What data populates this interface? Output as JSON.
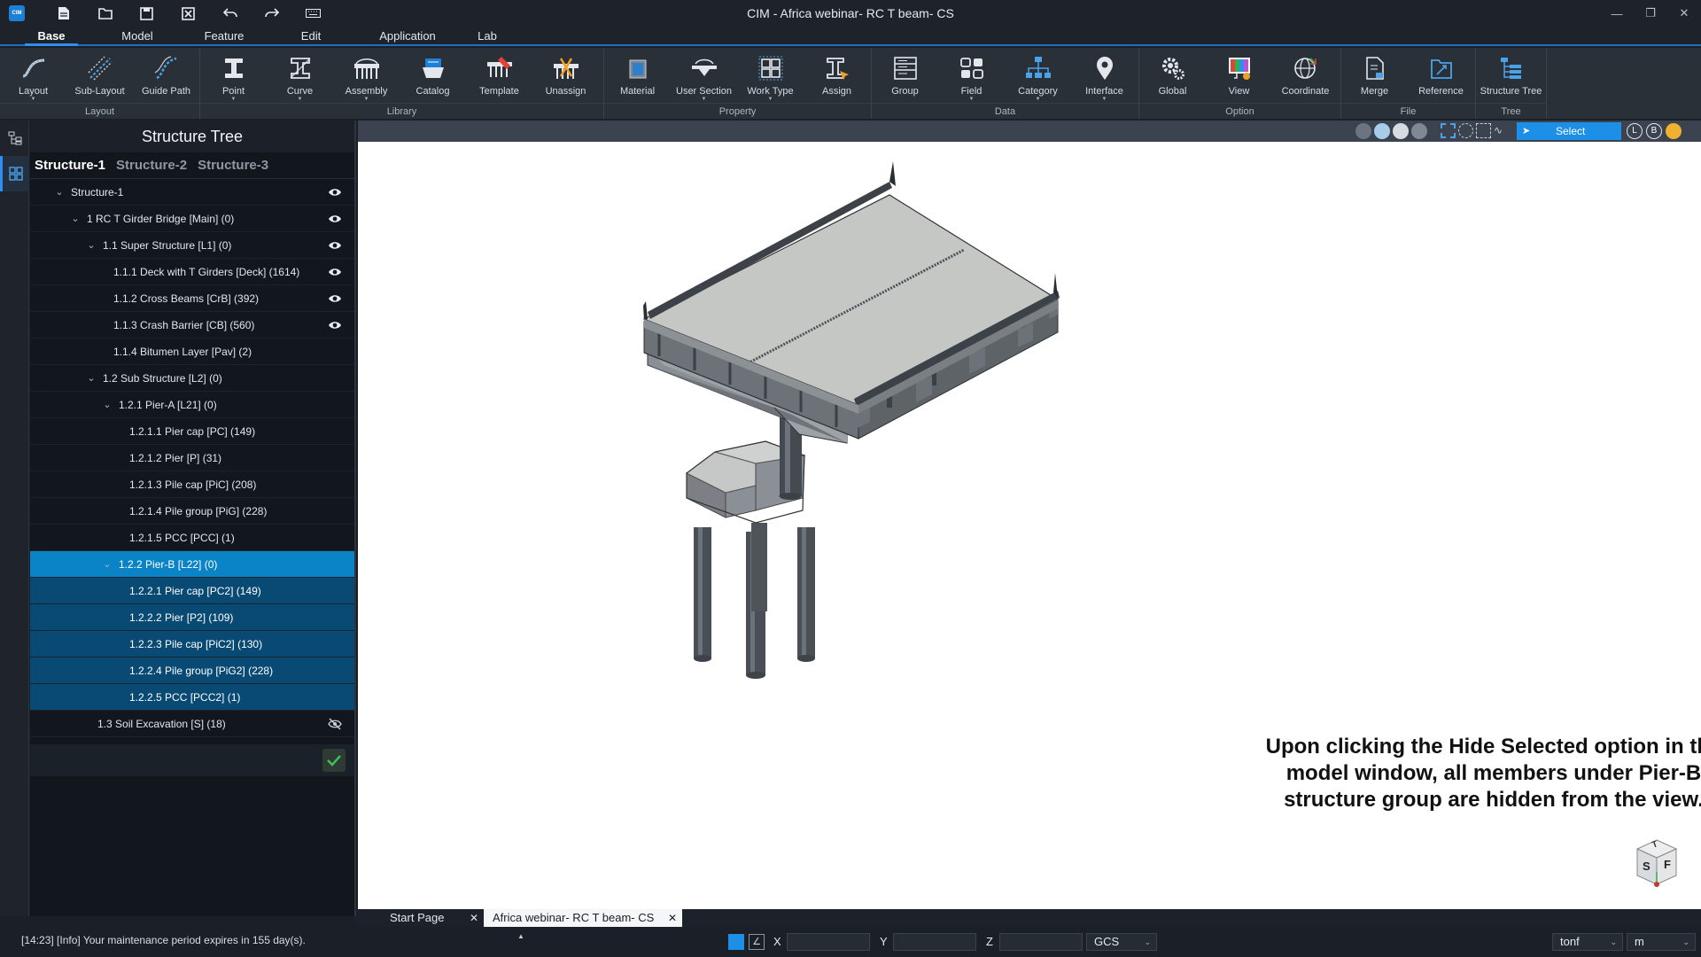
{
  "window": {
    "title": "CIM - Africa webinar- RC T beam- CS",
    "app_icon_text": "CIM",
    "controls": [
      "minimize",
      "restore",
      "close"
    ]
  },
  "quick_access": [
    "new-file-icon",
    "open-folder-icon",
    "save-icon",
    "close-file-icon",
    "undo-icon",
    "redo-icon",
    "keyboard-icon"
  ],
  "menu": {
    "tabs": [
      "Base",
      "Model",
      "Feature",
      "Edit",
      "Application",
      "Lab"
    ],
    "active": "Base"
  },
  "ribbon": {
    "groups": [
      {
        "label": "Layout",
        "items": [
          {
            "label": "Layout",
            "icon": "layout-curve-icon",
            "caret": true
          },
          {
            "label": "Sub-Layout",
            "icon": "sub-layout-icon",
            "caret": false
          },
          {
            "label": "Guide Path",
            "icon": "guide-path-icon",
            "caret": false
          }
        ]
      },
      {
        "label": "Library",
        "items": [
          {
            "label": "Point",
            "icon": "point-section-icon",
            "caret": true
          },
          {
            "label": "Curve",
            "icon": "curve-section-icon",
            "caret": true
          },
          {
            "label": "Assembly",
            "icon": "assembly-icon",
            "caret": true
          },
          {
            "label": "Catalog",
            "icon": "catalog-icon",
            "caret": false
          },
          {
            "label": "Template",
            "icon": "template-icon",
            "caret": false
          },
          {
            "label": "Unassign",
            "icon": "unassign-icon",
            "caret": false
          }
        ]
      },
      {
        "label": "Property",
        "items": [
          {
            "label": "Material",
            "icon": "material-cube-icon",
            "caret": false
          },
          {
            "label": "User Section",
            "icon": "user-section-icon",
            "caret": true
          },
          {
            "label": "Work Type",
            "icon": "work-type-grid-icon",
            "caret": true
          },
          {
            "label": "Assign",
            "icon": "assign-icon",
            "caret": false
          }
        ]
      },
      {
        "label": "Data",
        "items": [
          {
            "label": "Group",
            "icon": "group-list-icon",
            "caret": false
          },
          {
            "label": "Field",
            "icon": "field-icon",
            "caret": true
          },
          {
            "label": "Category",
            "icon": "category-tree-icon",
            "caret": true
          },
          {
            "label": "Interface",
            "icon": "interface-pin-icon",
            "caret": true
          }
        ]
      },
      {
        "label": "Option",
        "items": [
          {
            "label": "Global",
            "icon": "gear-icon",
            "caret": false
          },
          {
            "label": "View",
            "icon": "view-palette-icon",
            "caret": false
          },
          {
            "label": "Coordinate",
            "icon": "coordinate-globe-icon",
            "caret": false
          }
        ]
      },
      {
        "label": "File",
        "items": [
          {
            "label": "Merge",
            "icon": "merge-file-icon",
            "caret": false
          },
          {
            "label": "Reference",
            "icon": "reference-file-icon",
            "caret": false
          }
        ]
      },
      {
        "label": "Tree",
        "items": [
          {
            "label": "Structure Tree",
            "icon": "structure-tree-icon",
            "caret": false
          }
        ]
      }
    ]
  },
  "tree_panel": {
    "title": "Structure Tree",
    "structure_tabs": [
      "Structure-1",
      "Structure-2",
      "Structure-3"
    ],
    "active_tab": "Structure-1",
    "nodes": [
      {
        "label": "Structure-1",
        "depth": 0,
        "toggle": "expanded",
        "eye": "visible",
        "state": "normal"
      },
      {
        "label": "1 RC T Girder Bridge [Main] (0)",
        "depth": 1,
        "toggle": "expanded",
        "eye": "visible",
        "state": "normal"
      },
      {
        "label": "1.1 Super Structure [L1] (0)",
        "depth": 2,
        "toggle": "expanded",
        "eye": "visible",
        "state": "normal"
      },
      {
        "label": "1.1.1 Deck with T Girders [Deck] (1614)",
        "depth": 3,
        "toggle": "none",
        "eye": "visible",
        "state": "normal"
      },
      {
        "label": "1.1.2 Cross Beams [CrB] (392)",
        "depth": 3,
        "toggle": "none",
        "eye": "visible",
        "state": "normal"
      },
      {
        "label": "1.1.3 Crash Barrier [CB] (560)",
        "depth": 3,
        "toggle": "none",
        "eye": "visible",
        "state": "normal"
      },
      {
        "label": "1.1.4 Bitumen Layer [Pav] (2)",
        "depth": 3,
        "toggle": "none",
        "eye": "none",
        "state": "normal"
      },
      {
        "label": "1.2 Sub Structure [L2] (0)",
        "depth": 2,
        "toggle": "expanded",
        "eye": "none",
        "state": "normal"
      },
      {
        "label": "1.2.1 Pier-A [L21] (0)",
        "depth": 3,
        "toggle": "expanded",
        "eye": "none",
        "state": "normal"
      },
      {
        "label": "1.2.1.1 Pier cap [PC] (149)",
        "depth": 4,
        "toggle": "none",
        "eye": "none",
        "state": "normal"
      },
      {
        "label": "1.2.1.2 Pier  [P] (31)",
        "depth": 4,
        "toggle": "none",
        "eye": "none",
        "state": "normal"
      },
      {
        "label": "1.2.1.3 Pile cap [PiC] (208)",
        "depth": 4,
        "toggle": "none",
        "eye": "none",
        "state": "normal"
      },
      {
        "label": "1.2.1.4 Pile group [PiG] (228)",
        "depth": 4,
        "toggle": "none",
        "eye": "none",
        "state": "normal"
      },
      {
        "label": "1.2.1.5 PCC [PCC] (1)",
        "depth": 4,
        "toggle": "none",
        "eye": "none",
        "state": "normal"
      },
      {
        "label": "1.2.2 Pier-B [L22] (0)",
        "depth": 3,
        "toggle": "expanded",
        "eye": "none",
        "state": "selected"
      },
      {
        "label": "1.2.2.1 Pier cap [PC2] (149)",
        "depth": 4,
        "toggle": "none",
        "eye": "none",
        "state": "sub"
      },
      {
        "label": "1.2.2.2 Pier  [P2] (109)",
        "depth": 4,
        "toggle": "none",
        "eye": "none",
        "state": "sub"
      },
      {
        "label": "1.2.2.3 Pile cap [PiC2] (130)",
        "depth": 4,
        "toggle": "none",
        "eye": "none",
        "state": "sub"
      },
      {
        "label": "1.2.2.4 Pile group [PiG2] (228)",
        "depth": 4,
        "toggle": "none",
        "eye": "none",
        "state": "sub"
      },
      {
        "label": "1.2.2.5 PCC [PCC2] (1)",
        "depth": 4,
        "toggle": "none",
        "eye": "none",
        "state": "sub"
      },
      {
        "label": "1.3 Soil Excavation [S] (18)",
        "depth": 2,
        "toggle": "none",
        "eye": "hidden",
        "state": "normal"
      }
    ]
  },
  "view_toolbar": {
    "select_label": "Select"
  },
  "viewport": {
    "caption_lines": [
      "Upon clicking the Hide Selected option in the",
      "model window, all members under Pier-B",
      "structure group are hidden from the view."
    ],
    "view_cube_faces": [
      "S",
      "F",
      "T"
    ]
  },
  "doc_tabs": [
    {
      "label": "Start Page",
      "active": false
    },
    {
      "label": "Africa webinar- RC T beam- CS",
      "active": true
    }
  ],
  "status_bar": {
    "message": "[14:23] [Info] Your maintenance period expires in 155 day(s).",
    "coords": {
      "x_label": "X",
      "y_label": "Y",
      "z_label": "Z",
      "x": "",
      "y": "",
      "z": ""
    },
    "coord_system": "GCS",
    "force_unit": "tonf",
    "length_unit": "m"
  },
  "colors": {
    "accent": "#2d8ff0",
    "selected_row": "#0a84c6",
    "selected_children": "#084a74",
    "panel_bg": "#12171e"
  }
}
